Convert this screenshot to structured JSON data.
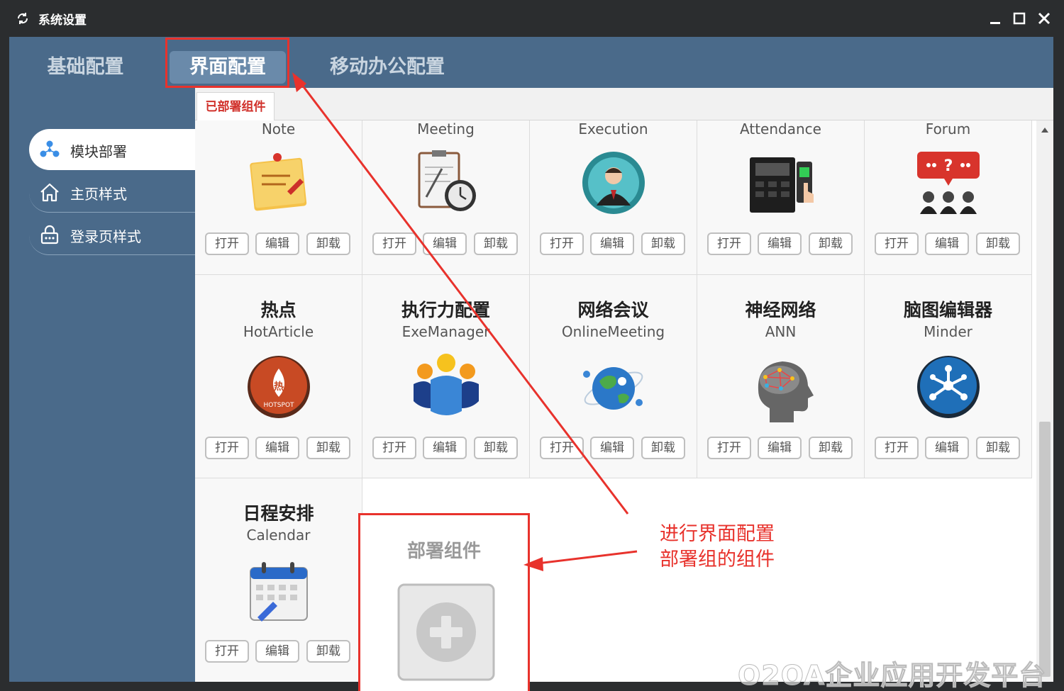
{
  "window": {
    "title": "系统设置"
  },
  "top_tabs": {
    "basic": "基础配置",
    "ui": "界面配置",
    "mobile": "移动办公配置"
  },
  "sidebar": {
    "items": [
      {
        "label": "模块部署",
        "icon": "module-deploy-icon",
        "active": true
      },
      {
        "label": "主页样式",
        "icon": "home-icon",
        "active": false
      },
      {
        "label": "登录页样式",
        "icon": "login-page-icon",
        "active": false
      }
    ]
  },
  "subtab": {
    "label": "已部署组件"
  },
  "card_buttons": {
    "open": "打开",
    "edit": "编辑",
    "uninstall": "卸载"
  },
  "components": [
    {
      "cn": "",
      "en": "Note",
      "icon": "note-icon"
    },
    {
      "cn": "",
      "en": "Meeting",
      "icon": "meeting-icon"
    },
    {
      "cn": "",
      "en": "Execution",
      "icon": "execution-icon"
    },
    {
      "cn": "",
      "en": "Attendance",
      "icon": "attendance-icon"
    },
    {
      "cn": "",
      "en": "Forum",
      "icon": "forum-icon"
    },
    {
      "cn": "热点",
      "en": "HotArticle",
      "icon": "hotspot-icon"
    },
    {
      "cn": "执行力配置",
      "en": "ExeManager",
      "icon": "team-icon"
    },
    {
      "cn": "网络会议",
      "en": "OnlineMeeting",
      "icon": "globe-icon"
    },
    {
      "cn": "神经网络",
      "en": "ANN",
      "icon": "brain-icon"
    },
    {
      "cn": "脑图编辑器",
      "en": "Minder",
      "icon": "mind-map-icon"
    },
    {
      "cn": "日程安排",
      "en": "Calendar",
      "icon": "calendar-icon"
    }
  ],
  "add_component": {
    "title": "部署组件"
  },
  "annotation": {
    "line1": "进行界面配置",
    "line2": "部署组的组件"
  },
  "watermark": "O2OA企业应用开发平台",
  "colors": {
    "frame": "#4a6a8a",
    "accent_red": "#e8322c",
    "active_tab": "#6a8aaa",
    "titlebar": "#2b2d2f"
  }
}
